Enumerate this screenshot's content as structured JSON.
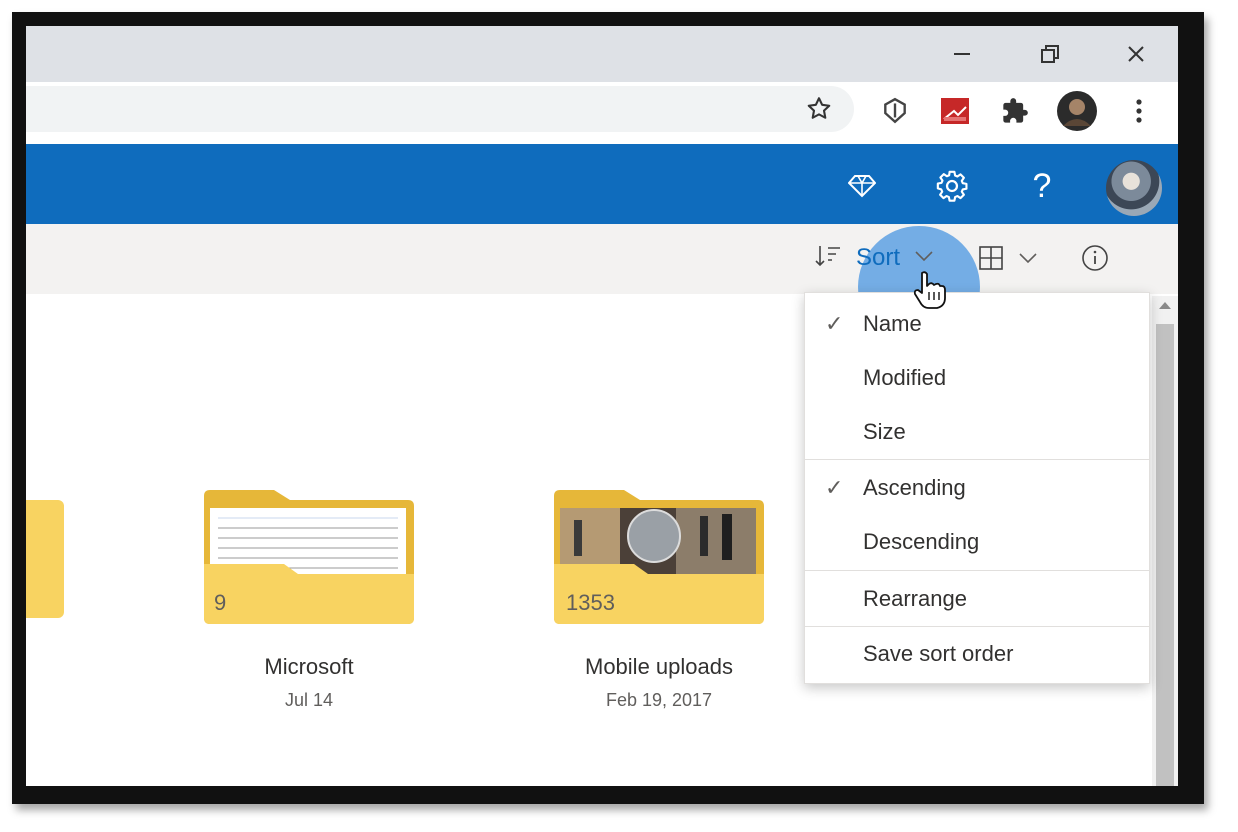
{
  "window": {
    "minimize_icon": "minimize-icon",
    "restore_icon": "restore-icon",
    "close_icon": "close-icon"
  },
  "browser_toolbar": {
    "icons": [
      "star-icon",
      "shield-extension-icon",
      "red-extension-icon",
      "puzzle-icon",
      "profile-avatar",
      "kebab-menu-icon"
    ]
  },
  "header": {
    "icons": [
      "diamond-icon",
      "gear-icon",
      "help-icon"
    ],
    "help_glyph": "?",
    "accent_color": "#0f6cbd"
  },
  "command_bar": {
    "sort_label": "Sort",
    "view_icon": "grid-view-icon",
    "info_icon": "info-icon"
  },
  "sort_menu": {
    "items": [
      {
        "label": "Name",
        "checked": true
      },
      {
        "label": "Modified",
        "checked": false
      },
      {
        "label": "Size",
        "checked": false
      },
      {
        "label": "Ascending",
        "checked": true
      },
      {
        "label": "Descending",
        "checked": false
      },
      {
        "label": "Rearrange",
        "checked": false
      },
      {
        "label": "Save sort order",
        "checked": false
      }
    ],
    "check_glyph": "✓"
  },
  "folders": [
    {
      "name": "Microsoft",
      "date": "Jul 14",
      "count": "9"
    },
    {
      "name": "Mobile uploads",
      "date": "Feb 19, 2017",
      "count": "1353"
    }
  ]
}
